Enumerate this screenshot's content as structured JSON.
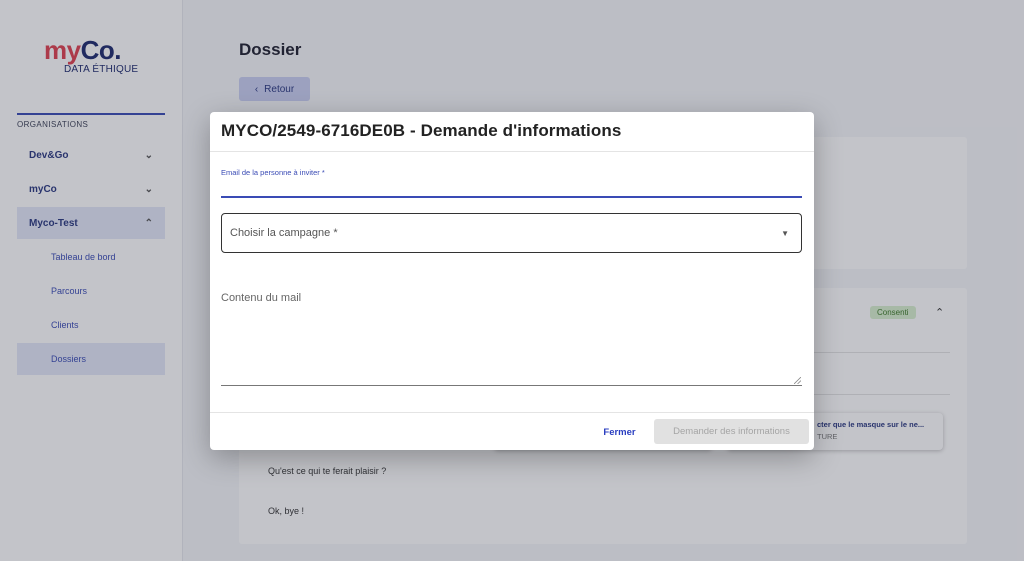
{
  "sidebar": {
    "logo": {
      "my": "my",
      "co": "Co.",
      "subtitle": "DATA ÉTHIQUE"
    },
    "section_label": "ORGANISATIONS",
    "orgs": [
      {
        "label": "Dev&Go",
        "chevron": "chevron-down"
      },
      {
        "label": "myCo",
        "chevron": "chevron-down"
      },
      {
        "label": "Myco-Test",
        "chevron": "chevron-up"
      }
    ],
    "sub_items": [
      {
        "label": "Tableau de bord"
      },
      {
        "label": "Parcours"
      },
      {
        "label": "Clients"
      },
      {
        "label": "Dossiers"
      }
    ]
  },
  "page": {
    "title": "Dossier",
    "back_label": "Retour",
    "back_icon": "‹",
    "consent_badge": "Consenti",
    "question_card": {
      "title": "cter que le masque sur le ne...",
      "subtitle": "TURE"
    },
    "text_lines": [
      "Qu'est ce qui te ferait plaisir ?",
      "Ok, bye !"
    ]
  },
  "modal": {
    "title": "MYCO/2549-6716DE0B - Demande d'informations",
    "email_label": "Email de la personne à inviter *",
    "email_value": "",
    "campaign_placeholder": "Choisir la campagne *",
    "mail_placeholder": "Contenu du mail",
    "close_label": "Fermer",
    "submit_label": "Demander des informations"
  },
  "colors": {
    "accent": "#3a4bb5",
    "brand_red": "#e0414f",
    "brand_navy": "#1e2a6e",
    "consent_bg": "#d9f0cf"
  }
}
